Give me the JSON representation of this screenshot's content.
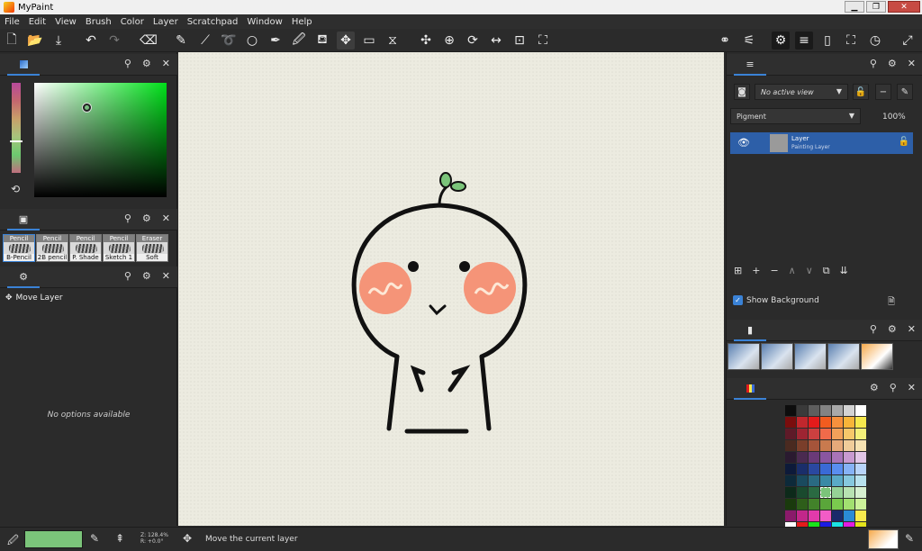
{
  "window": {
    "title": "MyPaint"
  },
  "menubar": [
    "File",
    "Edit",
    "View",
    "Brush",
    "Color",
    "Layer",
    "Scratchpad",
    "Window",
    "Help"
  ],
  "left_docks": {
    "color": {
      "icon": "color-wheel-icon"
    },
    "brushes": {
      "items": [
        {
          "name": "Pencil",
          "label": "B-Pencil"
        },
        {
          "name": "Pencil",
          "label": "2B pencil"
        },
        {
          "name": "Pencil",
          "label": "P. Shade"
        },
        {
          "name": "Pencil",
          "label": "Sketch 1"
        },
        {
          "name": "Eraser",
          "label": "Soft"
        }
      ]
    },
    "tool_options": {
      "title": "Move Layer",
      "empty": "No options available"
    }
  },
  "right_docks": {
    "layers": {
      "view_select": "No active view",
      "mode_select": "Pigment",
      "opacity": "100%",
      "layer": {
        "name": "Layer",
        "type": "Painting Layer"
      },
      "show_background_label": "Show Background"
    }
  },
  "status": {
    "zoom": "Z: 128.4%",
    "rotation": "R: +0.0°",
    "message": "Move the current layer"
  },
  "colors": {
    "current": "#7bc47a",
    "accent": "#3a82d6"
  },
  "palette": [
    "#0d0d0d",
    "#3a3a3a",
    "#5e5e5e",
    "#838383",
    "#a9a9a9",
    "#d3d3d3",
    "#ffffff",
    "#7a0d0d",
    "#c1272d",
    "#e31b1b",
    "#f25c1f",
    "#f6913d",
    "#f7b539",
    "#f6e94d",
    "#5e1a28",
    "#9e2432",
    "#cc4040",
    "#f06a4a",
    "#f2a15a",
    "#f6c86a",
    "#f4f07a",
    "#4a2a20",
    "#7a3e2a",
    "#a5543a",
    "#c97a4e",
    "#e6a97a",
    "#f0cc9a",
    "#f6e2b2",
    "#2a1a30",
    "#4a2a50",
    "#6a3a78",
    "#8a56a0",
    "#a874b8",
    "#c89ad0",
    "#e2c6e6",
    "#0d1a3a",
    "#1a2e6a",
    "#2a48a0",
    "#3a6ad6",
    "#5a8ef0",
    "#86b2f6",
    "#b8d4fa",
    "#0d2a3a",
    "#1a4a5e",
    "#2a6a82",
    "#3a8aa6",
    "#5aaac6",
    "#86c8de",
    "#b8e2ee",
    "#0d2a1a",
    "#1a4a2e",
    "#2a6a42",
    "#7bc47a",
    "#96d296",
    "#b8e2b2",
    "#d6f0d0",
    "#1a3a0d",
    "#2e5e1a",
    "#42822a",
    "#5aa63a",
    "#7aca4e",
    "#a2e070",
    "#ccf29a",
    "#8a1a6a",
    "#c2278a",
    "#e23aaa",
    "#f25cc6",
    "#1a2a6a",
    "#2a8ad6",
    "#f6e94d",
    "#ffffff",
    "#e31b1b",
    "#1ae31b",
    "#1b1be3",
    "#1be3e3",
    "#e31be3",
    "#e3e31b"
  ]
}
